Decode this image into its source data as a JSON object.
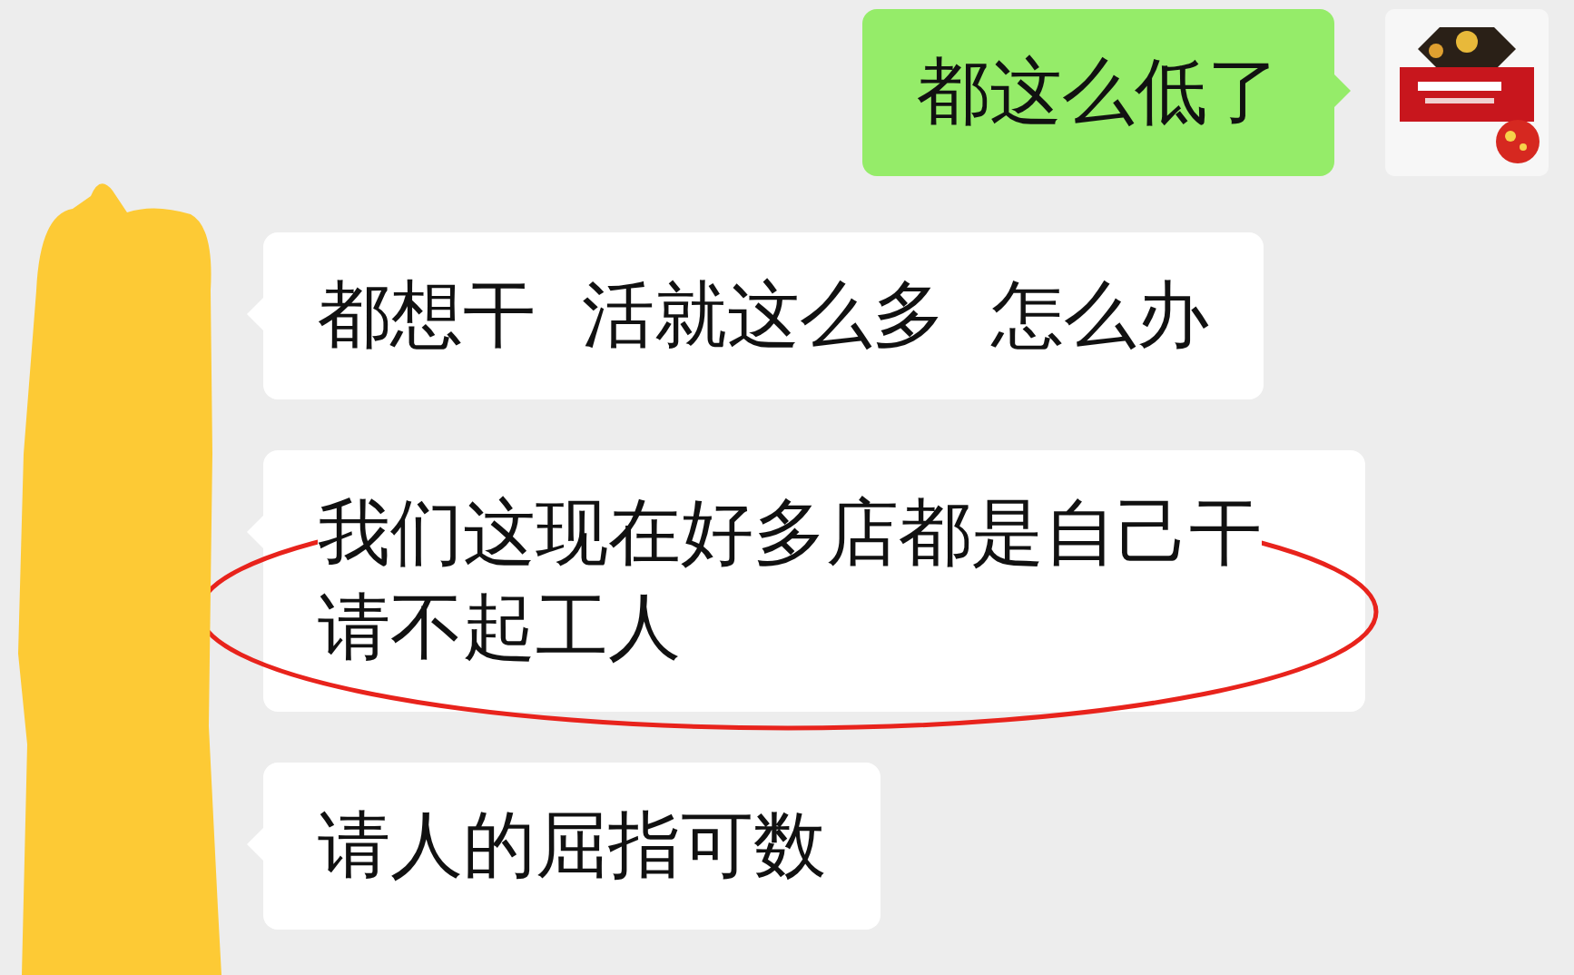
{
  "sender_redacted": true,
  "messages": [
    {
      "kind": "sent",
      "text": "都这么低了",
      "circled": false
    },
    {
      "kind": "received",
      "text": "都想干  活就这么多  怎么办",
      "circled": false
    },
    {
      "kind": "received",
      "text": "我们这现在好多店都是自己干请不起工人",
      "circled": true
    },
    {
      "kind": "received",
      "text": "请人的屈指可数",
      "circled": false
    }
  ]
}
